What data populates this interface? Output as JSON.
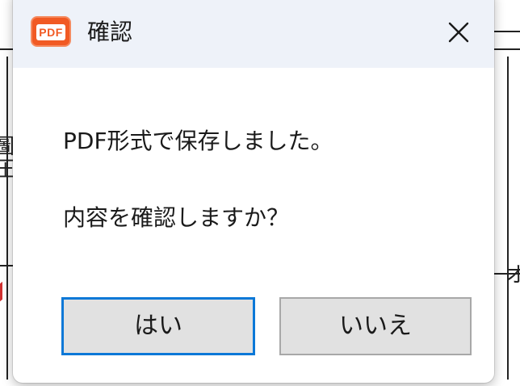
{
  "background_window": {
    "fragment_left": "圖\n圧",
    "fragment_right": "オ"
  },
  "dialog": {
    "app_icon_label": "PDF",
    "title": "確認",
    "close_glyph": "close-icon",
    "message_line1": "PDF形式で保存しました。",
    "message_line2": "内容を確認しますか？",
    "buttons": {
      "yes_label": "はい",
      "no_label": "いいえ"
    }
  },
  "colors": {
    "titlebar": "#eef2f9",
    "icon_brand": "#f15a24",
    "default_button_border": "#0b78d7",
    "button_face": "#e1e1e1"
  }
}
